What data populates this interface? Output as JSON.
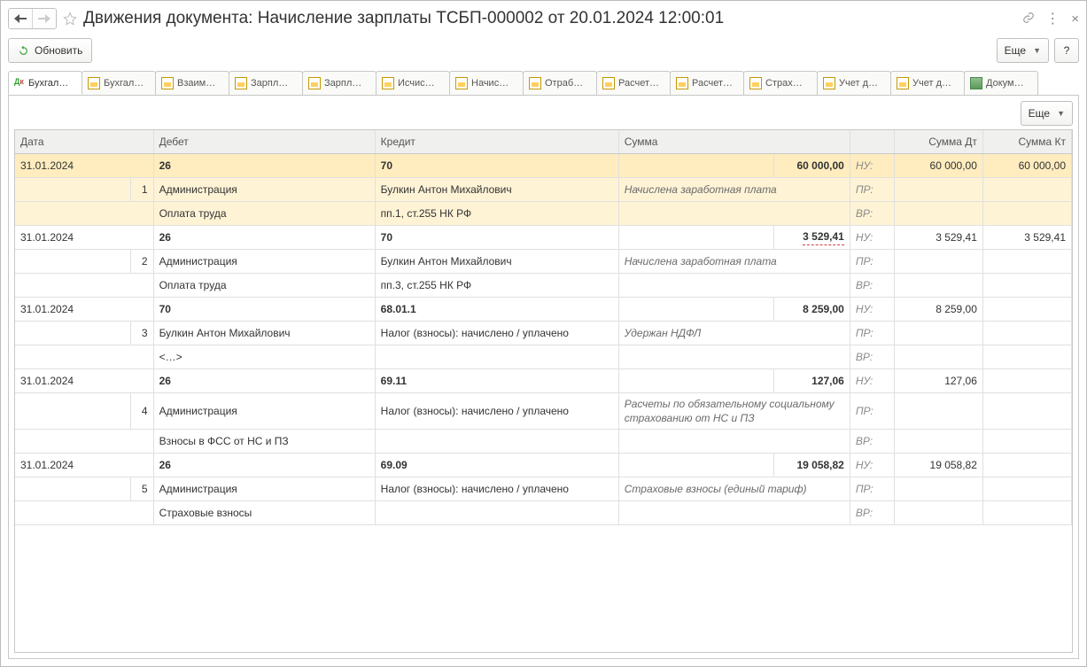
{
  "title": "Движения документа: Начисление зарплаты ТСБП-000002 от 20.01.2024 12:00:01",
  "toolbar": {
    "refresh": "Обновить",
    "more": "Еще",
    "help": "?"
  },
  "tabs": [
    {
      "label": "Бухгал…",
      "icon": "dk",
      "active": true
    },
    {
      "label": "Бухгал…",
      "icon": "sheet"
    },
    {
      "label": "Взаим…",
      "icon": "sheet"
    },
    {
      "label": "Зарпл…",
      "icon": "sheet"
    },
    {
      "label": "Зарпл…",
      "icon": "sheet"
    },
    {
      "label": "Исчис…",
      "icon": "sheet"
    },
    {
      "label": "Начис…",
      "icon": "sheet"
    },
    {
      "label": "Отраб…",
      "icon": "sheet"
    },
    {
      "label": "Расчет…",
      "icon": "sheet"
    },
    {
      "label": "Расчет…",
      "icon": "sheet"
    },
    {
      "label": "Страх…",
      "icon": "sheet"
    },
    {
      "label": "Учет д…",
      "icon": "sheet"
    },
    {
      "label": "Учет д…",
      "icon": "sheet"
    },
    {
      "label": "Докум…",
      "icon": "grid"
    }
  ],
  "panel": {
    "more": "Еще"
  },
  "columns": {
    "date": "Дата",
    "debit": "Дебет",
    "credit": "Кредит",
    "sum": "Сумма",
    "sum_dt": "Сумма Дт",
    "sum_kt": "Сумма Кт"
  },
  "tags": {
    "nu": "НУ:",
    "pr": "ПР:",
    "vr": "ВР:"
  },
  "entries": [
    {
      "n": 1,
      "date": "31.01.2024",
      "selected": true,
      "debit_acc": "26",
      "credit_acc": "70",
      "sum": "60 000,00",
      "sum_dt": "60 000,00",
      "sum_kt": "60 000,00",
      "debit_s1": "Администрация",
      "credit_s1": "Булкин Антон Михайлович",
      "desc": "Начислена заработная плата",
      "debit_s2": "Оплата труда",
      "credit_s2": "пп.1, ст.255 НК РФ"
    },
    {
      "n": 2,
      "date": "31.01.2024",
      "debit_acc": "26",
      "credit_acc": "70",
      "sum": "3 529,41",
      "sum_underline": true,
      "sum_dt": "3 529,41",
      "sum_kt": "3 529,41",
      "debit_s1": "Администрация",
      "credit_s1": "Булкин Антон Михайлович",
      "desc": "Начислена заработная плата",
      "debit_s2": "Оплата труда",
      "credit_s2": "пп.3, ст.255 НК РФ"
    },
    {
      "n": 3,
      "date": "31.01.2024",
      "debit_acc": "70",
      "credit_acc": "68.01.1",
      "sum": "8 259,00",
      "sum_dt": "8 259,00",
      "sum_kt": "",
      "debit_s1": "Булкин Антон Михайлович",
      "credit_s1": "Налог (взносы): начислено / уплачено",
      "desc": "Удержан НДФЛ",
      "debit_s2": "<…>",
      "credit_s2": ""
    },
    {
      "n": 4,
      "date": "31.01.2024",
      "debit_acc": "26",
      "credit_acc": "69.11",
      "sum": "127,06",
      "sum_dt": "127,06",
      "sum_kt": "",
      "debit_s1": "Администрация",
      "credit_s1": "Налог (взносы): начислено / уплачено",
      "desc": "Расчеты по обязательному социальному страхованию от НС и ПЗ",
      "debit_s2": "Взносы в ФСС от НС и ПЗ",
      "credit_s2": ""
    },
    {
      "n": 5,
      "date": "31.01.2024",
      "debit_acc": "26",
      "credit_acc": "69.09",
      "sum": "19 058,82",
      "sum_dt": "19 058,82",
      "sum_kt": "",
      "debit_s1": "Администрация",
      "credit_s1": "Налог (взносы): начислено / уплачено",
      "desc": "Страховые взносы (единый тариф)",
      "debit_s2": "Страховые взносы",
      "credit_s2": ""
    }
  ]
}
